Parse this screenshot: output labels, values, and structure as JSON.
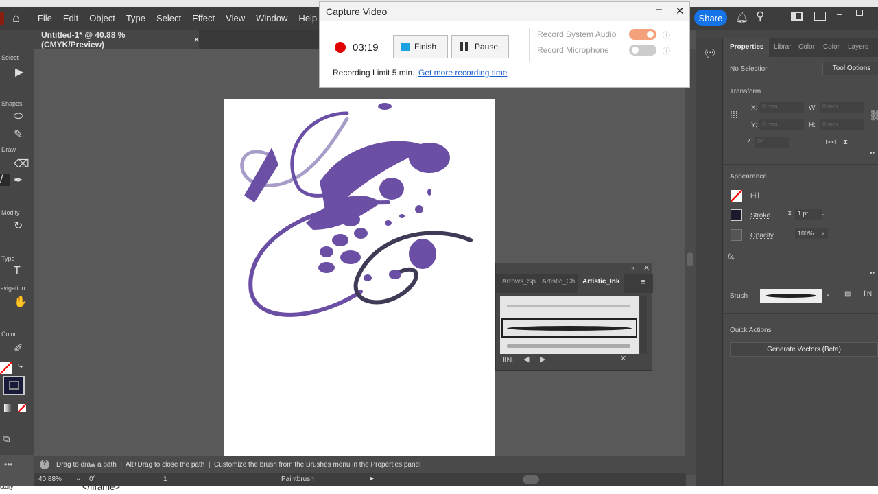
{
  "menu": [
    "File",
    "Edit",
    "Object",
    "Type",
    "Select",
    "Effect",
    "View",
    "Window",
    "Help"
  ],
  "document_tab": {
    "title": "Untitled-1* @ 40.88 % (CMYK/Preview)",
    "close": "×"
  },
  "toolbar": {
    "sections": [
      "Select",
      "Shapes",
      "Draw",
      "Modify",
      "Type",
      "Navigation",
      "Color"
    ],
    "more": "•••"
  },
  "top_right": {
    "share": "Share"
  },
  "capture": {
    "title": "Capture Video",
    "time": "03:19",
    "finish": "Finish",
    "pause": "Pause",
    "system_audio": "Record System Audio",
    "microphone": "Record Microphone",
    "system_audio_on": true,
    "microphone_on": false,
    "limit_text": "Recording Limit 5 min.",
    "link": "Get more recording time",
    "accent": "#1473e6",
    "record_color": "#e00000"
  },
  "properties": {
    "tabs": [
      "Properties",
      "Librar",
      "Color",
      "Color",
      "Layers"
    ],
    "no_selection": "No Selection",
    "tool_options": "Tool Options",
    "transform": "Transform",
    "x_label": "X:",
    "y_label": "Y:",
    "w_label": "W:",
    "h_label": "H:",
    "x": "0 mm",
    "y": "0 mm",
    "w": "0 mm",
    "h": "0 mm",
    "angle": "0°",
    "appearance": "Appearance",
    "fill": "Fill",
    "stroke": "Stroke",
    "stroke_value": "1 pt",
    "opacity": "Opacity",
    "opacity_value": "100%",
    "fx": "fx.",
    "brush": "Brush",
    "quick_actions": "Quick Actions",
    "generate": "Generate Vectors (Beta)"
  },
  "brushes": {
    "tabs": [
      "Arrows_Sp",
      "Artistic_Ch",
      "Artistic_Ink"
    ]
  },
  "status": {
    "hint": "Drag to draw a path  |  Alt+Drag to close the path  |  Customize the brush from the Brushes menu in the Properties panel",
    "zoom": "40.88%",
    "rotation": "0°",
    "artboard": "1",
    "tool": "Paintbrush"
  },
  "code_strip": {
    "text": "</iframe>",
    "left": "ctory"
  }
}
